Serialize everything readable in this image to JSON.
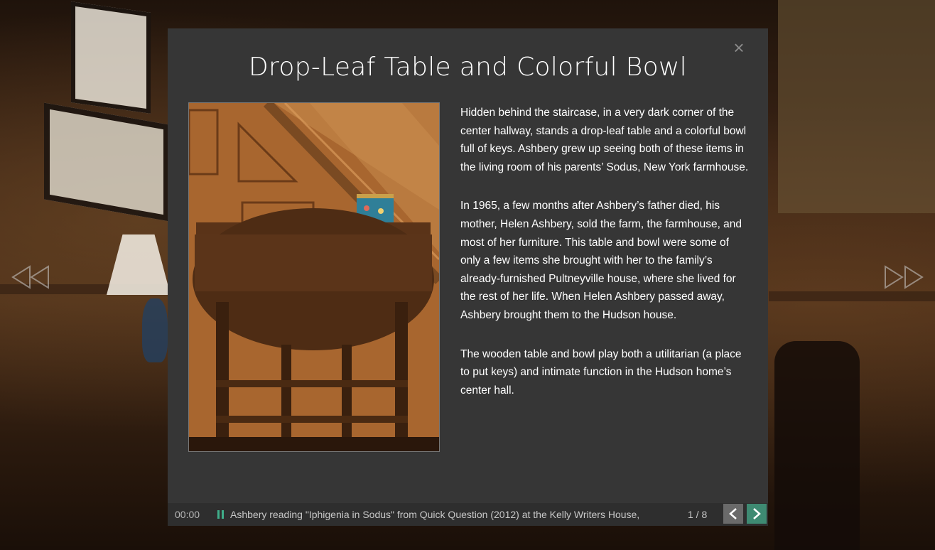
{
  "modal": {
    "title": "Drop-Leaf Table and Colorful Bowl",
    "close_label": "×",
    "image_icon": "photo-drop-leaf-table",
    "paragraphs": [
      "Hidden behind the staircase, in a very dark corner of the center hallway, stands a drop-leaf table and a colorful bowl full of keys.  Ashbery grew up seeing both of these items in the living room of his parents’ Sodus, New York farmhouse.",
      "In 1965, a few months after Ashbery’s father died, his mother, Helen Ashbery, sold the farm, the farmhouse, and most of her furniture.  This table and bowl were some of only a few items she brought with her to the family’s already-furnished Pultneyville house, where she lived for the rest of her life. When Helen Ashbery passed away, Ashbery brought them to the Hudson house.",
      "The wooden table and bowl play both a utilitarian (a place to put keys) and intimate function in the Hudson home’s center hall."
    ]
  },
  "audio": {
    "time": "00:00",
    "track_title": "Ashbery reading \"Iphigenia in Sodus\" from Quick Question (2012) at the Kelly Writers House,",
    "counter": "1 / 8",
    "accent_color": "#3e8a72"
  },
  "nav": {
    "left_icon": "double-chevron-left-icon",
    "right_icon": "double-chevron-right-icon"
  }
}
